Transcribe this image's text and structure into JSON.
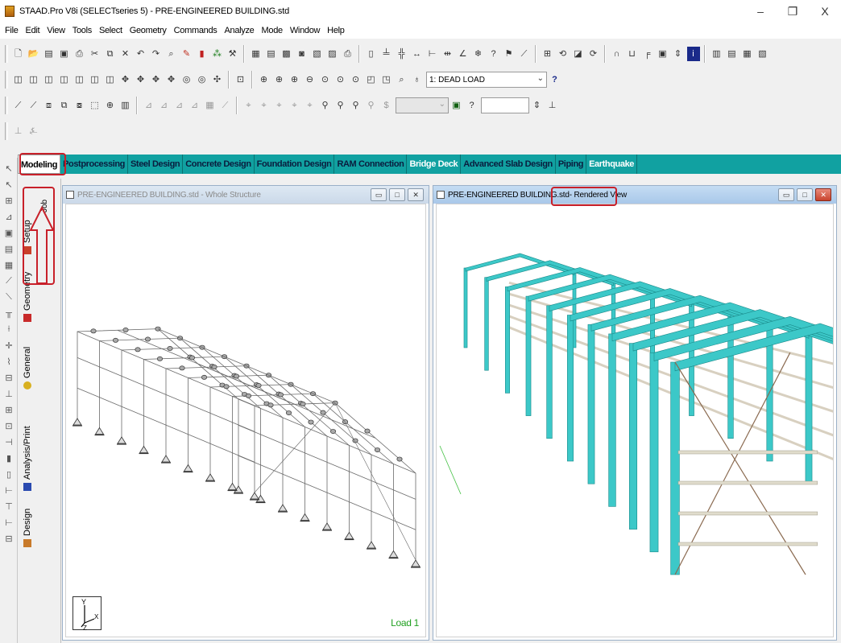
{
  "window": {
    "title": "STAAD.Pro V8i (SELECTseries 5) - PRE-ENGINEERED BUILDING.std",
    "minimize": "–",
    "restore": "❐",
    "close": "X"
  },
  "menu": [
    "File",
    "Edit",
    "View",
    "Tools",
    "Select",
    "Geometry",
    "Commands",
    "Analyze",
    "Mode",
    "Window",
    "Help"
  ],
  "toolbar": {
    "load_case": "1: DEAD LOAD"
  },
  "mode_tabs": [
    {
      "label": "Modeling",
      "state": "active"
    },
    {
      "label": "Postprocessing",
      "state": "dark"
    },
    {
      "label": "Steel Design",
      "state": "dark"
    },
    {
      "label": "Concrete Design",
      "state": "dark"
    },
    {
      "label": "Foundation Design",
      "state": "dark"
    },
    {
      "label": "RAM Connection",
      "state": "dark"
    },
    {
      "label": "Bridge Deck",
      "state": "light"
    },
    {
      "label": "Advanced Slab Design",
      "state": "dark"
    },
    {
      "label": "Piping",
      "state": "dark"
    },
    {
      "label": "Earthquake",
      "state": "light"
    }
  ],
  "page_tabs": {
    "setup": "Setup",
    "job": "Job",
    "geometry": "Geometry",
    "general": "General",
    "analysis": "Analysis/Print",
    "design": "Design"
  },
  "left_window": {
    "title": "PRE-ENGINEERED BUILDING.std - Whole Structure",
    "load_label": "Load 1",
    "axis_y": "Y",
    "axis_x": "X",
    "axis_z": "Z"
  },
  "right_window": {
    "title_file": "PRE-ENGINEERED BUILDING.std",
    "title_view": " - Rendered View"
  },
  "colors": {
    "mode_strip": "#11a1a1",
    "highlight": "#c8202a",
    "member_render": "#3cc8c8",
    "load_text": "#20a020"
  }
}
